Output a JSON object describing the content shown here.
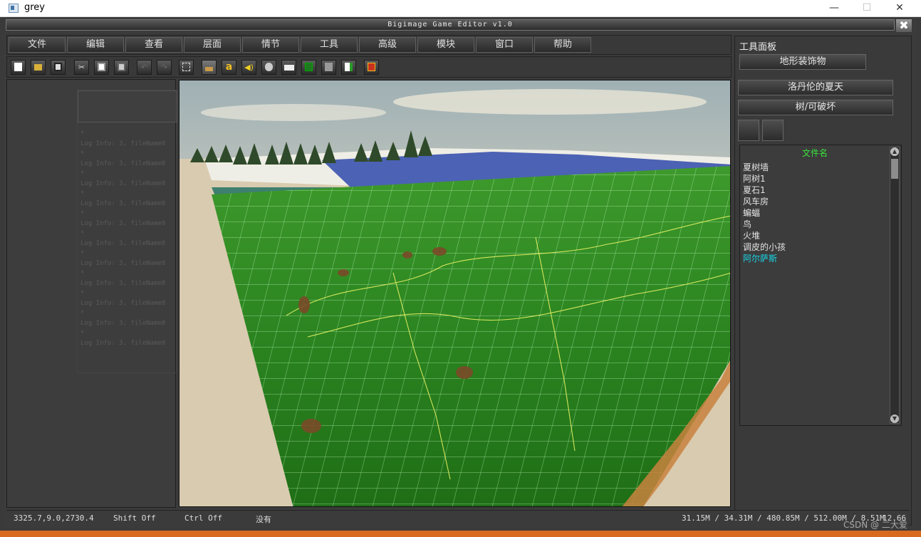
{
  "window": {
    "title": "grey",
    "min": "—",
    "max": "☐",
    "close": "✕"
  },
  "app": {
    "caption": "Bigimage Game Editor v1.0",
    "close_glyph": "✖",
    "menu": [
      "文件",
      "编辑",
      "查看",
      "层面",
      "情节",
      "工具",
      "高级",
      "模块",
      "窗口",
      "帮助"
    ],
    "toolbar_icons": [
      "new-file-icon",
      "open-folder-icon",
      "save-icon",
      "cut-icon",
      "copy-icon",
      "paste-icon",
      "undo-icon",
      "redo-icon",
      "select-rect-icon",
      "terrain-icon",
      "text-a-icon",
      "sound-icon",
      "character-icon",
      "book-icon",
      "script-icon",
      "object-icon",
      "export-icon",
      "record-icon"
    ],
    "text_tool_glyph": "a",
    "log_lines": [
      "Log Info: 3, fileName0",
      "Log Info: 3, fileName0",
      "Log Info: 3, fileName0",
      "Log Info: 3, fileName0",
      "Log Info: 3, fileName0",
      "Log Info: 3, fileName0",
      "Log Info: 3, fileName0",
      "Log Info: 3, fileName0",
      "Log Info: 3, fileName0",
      "Log Info: 3, fileName0",
      "Log Info: 3, fileName0"
    ]
  },
  "tool_panel": {
    "title": "工具面板",
    "tab": "地形装饰物",
    "buttons": [
      "洛丹伦的夏天",
      "树/可破坏"
    ],
    "file_header": "文件名",
    "files": [
      "夏树墙",
      "阿树1",
      "夏石1",
      "风车房",
      "蝙蝠",
      "鸟",
      "火堆",
      "调皮的小孩",
      "阿尔萨斯"
    ],
    "selected_index": 8
  },
  "status": {
    "coords": "3325.7,9.0,2730.4",
    "shift": "Shift Off",
    "ctrl": "Ctrl Off",
    "mode": "没有",
    "memory": "31.15M / 34.31M / 480.85M / 512.00M / 8.51M",
    "fps": "12.66"
  },
  "watermark": "CSDN @ 二大爱",
  "colors": {
    "grid": "#b8ffb8",
    "ridge": "#e8f060",
    "grass": "#2f8a1e",
    "water": "#4a62b0",
    "sky": "#e0d8c4"
  }
}
